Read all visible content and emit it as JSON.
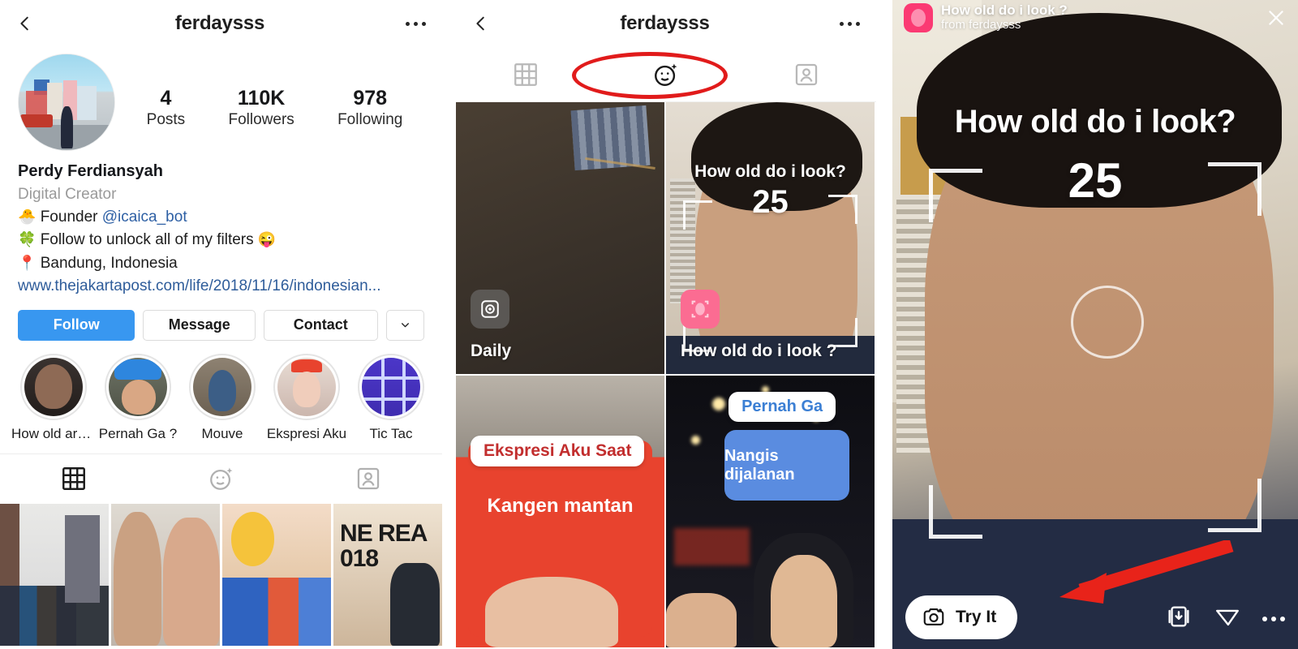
{
  "panel1": {
    "nav": {
      "back_icon": "chevron-left-icon",
      "title": "ferdaysss",
      "more_icon": "ellipsis-icon"
    },
    "avatar_alt": "profile-photo",
    "stats": [
      {
        "num": "4",
        "label": "Posts"
      },
      {
        "num": "110K",
        "label": "Followers"
      },
      {
        "num": "978",
        "label": "Following"
      }
    ],
    "bio": {
      "name": "Perdy Ferdiansyah",
      "category": "Digital Creator",
      "lines": [
        {
          "emoji": "🐣",
          "text": "Founder ",
          "mention": "@icaica_bot",
          "tail": ""
        },
        {
          "emoji": "🍀",
          "text": "Follow to unlock all of my filters ",
          "mention": "",
          "tail": "😜"
        },
        {
          "emoji": "📍",
          "text": "Bandung, Indonesia",
          "mention": "",
          "tail": ""
        }
      ],
      "url": "www.thejakartapost.com/life/2018/11/16/indonesian..."
    },
    "buttons": {
      "follow": "Follow",
      "message": "Message",
      "contact": "Contact",
      "chevron": "chevron-down-icon"
    },
    "highlights": [
      {
        "label": "How old are..."
      },
      {
        "label": "Pernah Ga ?"
      },
      {
        "label": "Mouve"
      },
      {
        "label": "Ekspresi Aku"
      },
      {
        "label": "Tic Tac"
      }
    ],
    "tabs": [
      {
        "name": "grid-tab",
        "icon": "grid-icon",
        "active": true
      },
      {
        "name": "effects-tab",
        "icon": "smiley-sparkle-icon",
        "active": false
      },
      {
        "name": "tagged-tab",
        "icon": "person-card-icon",
        "active": false
      }
    ],
    "photo4_text": "NE\nREA\n018"
  },
  "panel2": {
    "nav": {
      "back_icon": "chevron-left-icon",
      "title": "ferdaysss",
      "more_icon": "ellipsis-icon"
    },
    "tabs": [
      {
        "name": "grid-tab",
        "icon": "grid-icon",
        "active": false
      },
      {
        "name": "effects-tab",
        "icon": "smiley-sparkle-icon",
        "active": true,
        "annotated": true
      },
      {
        "name": "tagged-tab",
        "icon": "person-card-icon",
        "active": false
      }
    ],
    "annotation_color": "#e11b1b",
    "effects": [
      {
        "label": "Daily",
        "badge_icon": "camera-effect-icon"
      },
      {
        "label": "How old do i look ?",
        "badge_icon": "face-effect-icon",
        "overlay_title": "How old do i look?",
        "overlay_number": "25"
      },
      {
        "label": "",
        "caption_top": "Ekspresi Aku Saat",
        "caption_bottom": "Kangen mantan"
      },
      {
        "label": "",
        "caption_top": "Pernah Ga",
        "caption_bottom": "Nangis dijalanan"
      }
    ]
  },
  "panel3": {
    "header": {
      "title": "How old do i look ?",
      "subtitle": "from ferdaysss",
      "avatar_icon": "effect-thumb-icon",
      "close_icon": "close-icon"
    },
    "overlay": {
      "title": "How old do i look?",
      "number": "25"
    },
    "try_button": {
      "label": "Try It",
      "icon": "camera-sparkle-icon"
    },
    "actions": [
      {
        "name": "save-button",
        "icon": "save-icon"
      },
      {
        "name": "share-button",
        "icon": "paper-plane-icon"
      },
      {
        "name": "more-button",
        "icon": "ellipsis-icon"
      }
    ],
    "arrow_annotation_color": "#e8231a"
  },
  "colors": {
    "instagram_blue": "#3897f0",
    "annotation_red": "#e11b1b",
    "link_blue": "#2e5c9a"
  }
}
